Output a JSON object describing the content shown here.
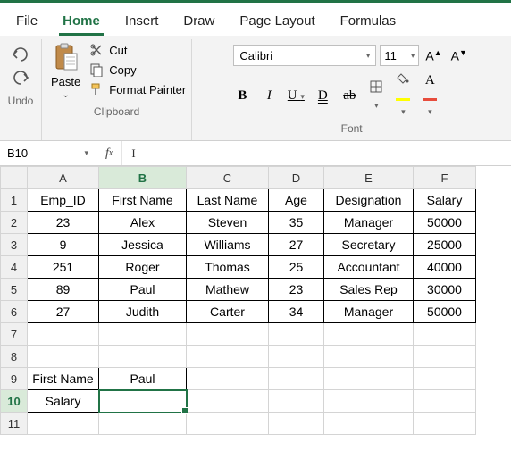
{
  "tabs": [
    "File",
    "Home",
    "Insert",
    "Draw",
    "Page Layout",
    "Formulas"
  ],
  "active_tab": "Home",
  "undo_group_label": "Undo",
  "clipboard": {
    "paste": "Paste",
    "cut": "Cut",
    "copy": "Copy",
    "format_painter": "Format Painter",
    "group_label": "Clipboard"
  },
  "font": {
    "name": "Calibri",
    "size": "11",
    "group_label": "Font",
    "inc": "A",
    "dec": "A"
  },
  "namebox": "B10",
  "columns": [
    "A",
    "B",
    "C",
    "D",
    "E",
    "F"
  ],
  "rows": [
    "1",
    "2",
    "3",
    "4",
    "5",
    "6",
    "7",
    "8",
    "9",
    "10",
    "11"
  ],
  "sel_col": "B",
  "sel_row": "10",
  "data": {
    "headers": [
      "Emp_ID",
      "First Name",
      "Last Name",
      "Age",
      "Designation",
      "Salary"
    ],
    "r2": [
      "23",
      "Alex",
      "Steven",
      "35",
      "Manager",
      "50000"
    ],
    "r3": [
      "9",
      "Jessica",
      "Williams",
      "27",
      "Secretary",
      "25000"
    ],
    "r4": [
      "251",
      "Roger",
      "Thomas",
      "25",
      "Accountant",
      "40000"
    ],
    "r5": [
      "89",
      "Paul",
      "Mathew",
      "23",
      "Sales Rep",
      "30000"
    ],
    "r6": [
      "27",
      "Judith",
      "Carter",
      "34",
      "Manager",
      "50000"
    ]
  },
  "lookup": {
    "a9": "First Name",
    "b9": "Paul",
    "a10": "Salary",
    "b10": ""
  }
}
